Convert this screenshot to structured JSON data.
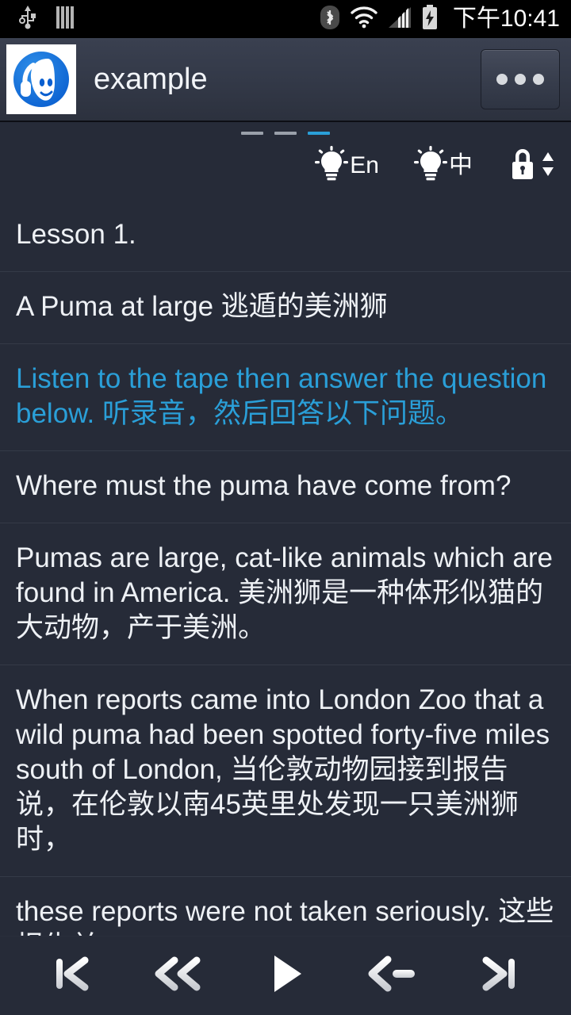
{
  "statusbar": {
    "icons": [
      "usb-icon",
      "vibrate-bars-icon",
      "bluetooth-icon",
      "wifi-icon",
      "cellular-signal-icon",
      "battery-charging-icon"
    ],
    "clock": "下午10:41"
  },
  "appbar": {
    "app_icon": "headphones-listener-icon",
    "title": "example",
    "overflow_label": "•••"
  },
  "subbar": {
    "page_indicator": {
      "count": 3,
      "active_index": 2
    },
    "tools": [
      {
        "icon": "lightbulb-icon",
        "label": "En",
        "name": "hint-english-toggle"
      },
      {
        "icon": "lightbulb-icon",
        "label": "中",
        "name": "hint-chinese-toggle"
      },
      {
        "icon": "lock-icon",
        "label": "",
        "name": "lock-scroll-toggle"
      }
    ]
  },
  "list": {
    "rows": [
      {
        "text": "Lesson 1.",
        "highlight": false
      },
      {
        "text": "A Puma at large  逃遁的美洲狮",
        "highlight": false
      },
      {
        "text": "Listen to the tape then answer the question below.  听录音，然后回答以下问题。",
        "highlight": true
      },
      {
        "text": "Where must the puma have come from?",
        "highlight": false
      },
      {
        "text": "Pumas are large, cat-like animals which are found in America.  美洲狮是一种体形似猫的大动物，产于美洲。",
        "highlight": false
      },
      {
        "text": "When reports came into London Zoo that a wild puma had been spotted forty-five miles south of London,  当伦敦动物园接到报告说，在伦敦以南45英里处发现一只美洲狮时，",
        "highlight": false
      },
      {
        "text": "these reports were not taken seriously.  这些报告并",
        "highlight": false
      }
    ]
  },
  "bottombar": {
    "controls": [
      {
        "name": "skip-to-start-button",
        "icon": "skip-previous-icon"
      },
      {
        "name": "rewind-button",
        "icon": "fast-rewind-icon"
      },
      {
        "name": "play-button",
        "icon": "play-icon"
      },
      {
        "name": "previous-sentence-button",
        "icon": "arrow-left-icon"
      },
      {
        "name": "skip-to-end-button",
        "icon": "skip-next-icon"
      }
    ]
  },
  "colors": {
    "background": "#262b38",
    "appbar": "#353b4a",
    "accent": "#2a9fd8",
    "text": "#eef1f5",
    "divider": "#343a47",
    "statusbar": "#000000"
  }
}
